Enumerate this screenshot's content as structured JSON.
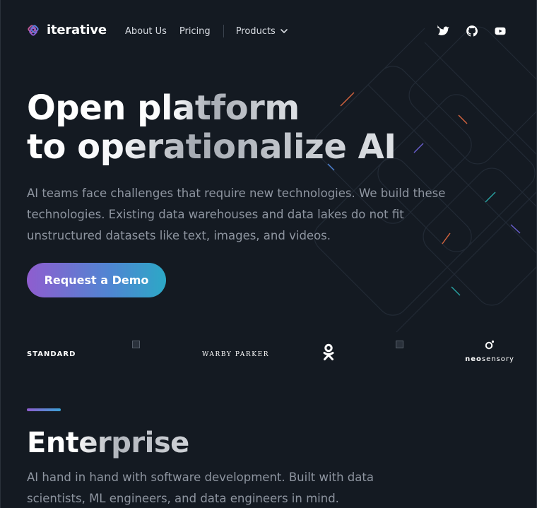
{
  "brand": {
    "name": "iterative",
    "logo_icon": "iterative-logo-icon",
    "colors": {
      "background": "#141a22",
      "accent_purple": "#8f5dcf",
      "accent_blue": "#2ca8c6",
      "muted_text": "#8e95a0"
    }
  },
  "nav": {
    "items": [
      {
        "label": "About Us"
      },
      {
        "label": "Pricing"
      }
    ],
    "products_label": "Products",
    "products_icon": "chevron-down-icon"
  },
  "socials": [
    "twitter-icon",
    "github-icon",
    "youtube-icon"
  ],
  "hero": {
    "title_line1_a": "Open ",
    "title_line1_b": "platform",
    "title_line2": "to operationalize AI",
    "description": "AI teams face challenges that require new technologies. We build these technologies. Existing data warehouses and data lakes do not fit unstructured datasets like text, images, and videos.",
    "cta_label": "Request a Demo"
  },
  "customers": {
    "standard": "STANDARD",
    "warby": "WARBY PARKER",
    "neo_prefix": "neo",
    "neo_suffix": "sensory",
    "ok_icon": "odnoklassniki-icon"
  },
  "enterprise": {
    "title": "Enterprise",
    "description": "AI hand in hand with software development. Built with data scientists, ML engineers, and data engineers in mind."
  }
}
